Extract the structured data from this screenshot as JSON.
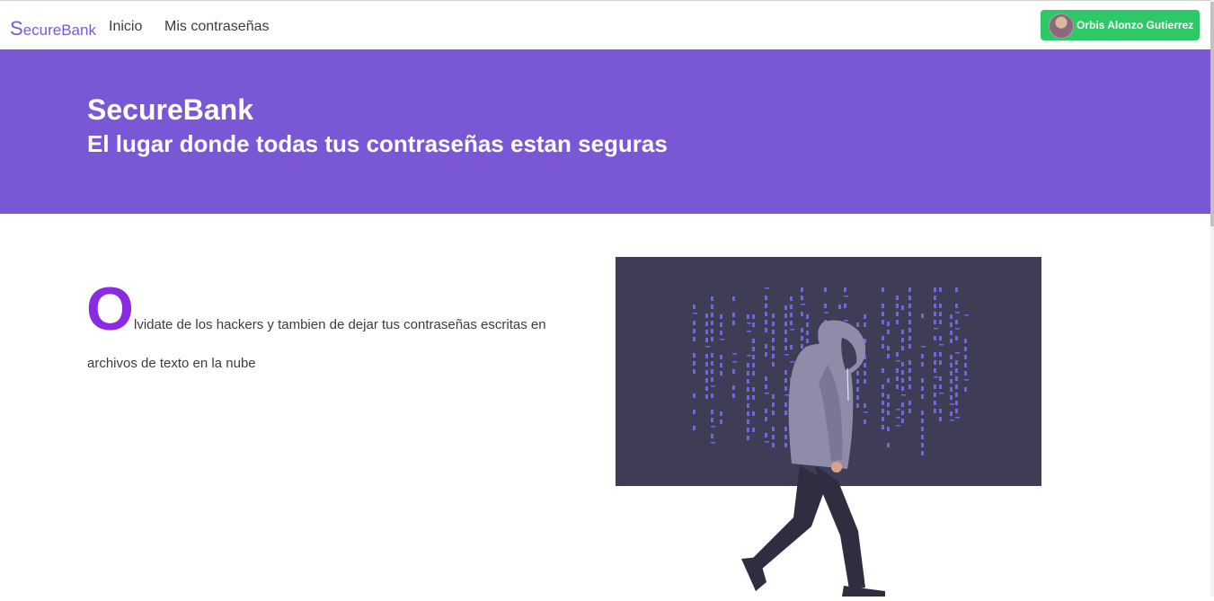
{
  "nav": {
    "brand_initial": "S",
    "brand_rest": "ecureBank",
    "links": [
      "Inicio",
      "Mis contraseñas"
    ],
    "user_name": "Orbis Alonzo Gutierrez"
  },
  "hero": {
    "title": "SecureBank",
    "subtitle": "El lugar donde todas tus contraseñas estan seguras"
  },
  "content": {
    "dropcap": "O",
    "line1": "lvidate de los hackers y tambien de dejar tus contraseñas escritas en",
    "line2": "archivos de texto en la nube"
  },
  "colors": {
    "hero_bg": "#7957d5",
    "user_button": "#2ec866",
    "dropcap": "#8a2be2",
    "panel": "#3f3d56",
    "code_glyphs": "#6c63ff"
  },
  "icons": {
    "avatar": "user-avatar",
    "illustration": "hooded-hacker-illustration"
  }
}
